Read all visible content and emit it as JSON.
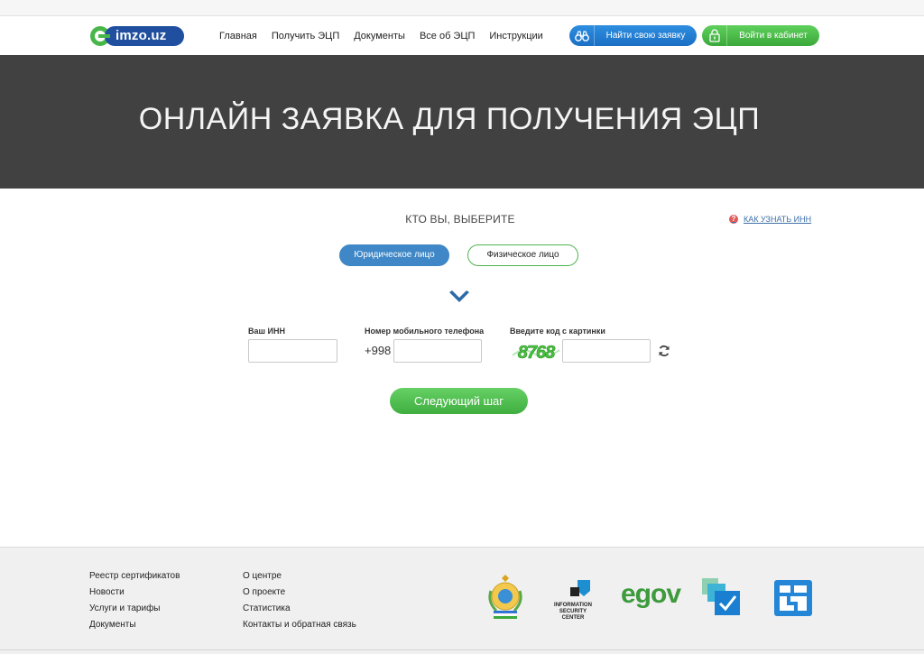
{
  "header": {
    "logo_text": "imzo.uz",
    "nav": [
      "Главная",
      "Получить ЭЦП",
      "Документы",
      "Все об ЭЦП",
      "Инструкции"
    ],
    "find_button": "Найти свою заявку",
    "login_button": "Войти в кабинет"
  },
  "hero": {
    "title": "ОНЛАЙН ЗАЯВКА ДЛЯ ПОЛУЧЕНИЯ ЭЦП"
  },
  "form": {
    "who_title": "КТО ВЫ, ВЫБЕРИТЕ",
    "inn_help": "КАК УЗНАТЬ ИНН",
    "inn_help_icon": "?",
    "type_legal": "Юридическое лицо",
    "type_physical": "Физическое лицо",
    "selected_type": "Юридическое лицо",
    "inn_label": "Ваш ИНН",
    "inn_value": "",
    "phone_label": "Номер мобильного телефона",
    "phone_prefix": "+998",
    "phone_value": "",
    "captcha_label": "Введите код с картинки",
    "captcha_text": "8768",
    "captcha_value": "",
    "next_button": "Следующий шаг"
  },
  "footer": {
    "col1": [
      "Реестр сертификатов",
      "Новости",
      "Услуги и тарифы",
      "Документы"
    ],
    "col2": [
      "О центре",
      "О проекте",
      "Статистика",
      "Контакты и обратная связь"
    ],
    "partners": {
      "isc_line1": "INFORMATION",
      "isc_line2": "SECURITY",
      "isc_line3": "CENTER",
      "egov": "egov"
    }
  },
  "colors": {
    "brand_blue": "#1f4f9e",
    "brand_green": "#48b649",
    "hero_bg": "#414141",
    "button_blue": "#3f87c6"
  }
}
